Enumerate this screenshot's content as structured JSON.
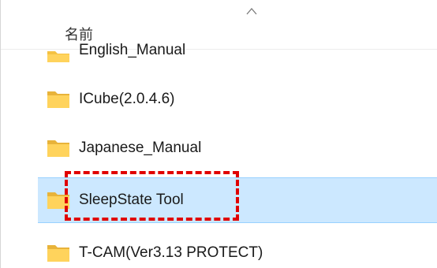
{
  "header": {
    "column_name": "名前",
    "sort_icon": "chevron-up-icon"
  },
  "rows": [
    {
      "label": "English_Manual",
      "icon": "folder-icon",
      "partial": true
    },
    {
      "label": "ICube(2.0.4.6)",
      "icon": "folder-icon"
    },
    {
      "label": "Japanese_Manual",
      "icon": "folder-icon"
    },
    {
      "label": "SleepState Tool",
      "icon": "folder-icon",
      "selected": true
    },
    {
      "label": "T-CAM(Ver3.13 PROTECT)",
      "icon": "folder-icon"
    }
  ],
  "annotation": {
    "style": "red-dashed-box",
    "target": "SleepState Tool"
  },
  "colors": {
    "folder": "#f5c242",
    "selection": "#cce8ff",
    "annotation": "#e00000"
  }
}
